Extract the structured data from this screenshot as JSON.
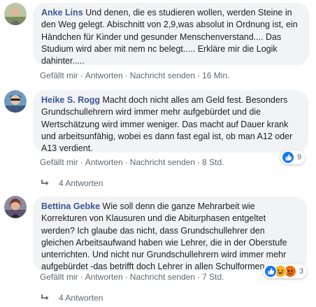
{
  "comments": [
    {
      "author": "Anke Lins",
      "text": "Und denen, die es studieren wollen, werden Steine in den Weg gelegt. Abischnitt von 2,9,was absolut in Ordnung ist, ein Händchen für Kinder und gesunder Menschenverstand.... Das Studium wird aber mit nem nc belegt..... Erkläre mir die Logik dahinter.....",
      "actions": {
        "like": "Gefällt mir",
        "reply": "Antworten",
        "message": "Nachricht senden",
        "time": "16 Min."
      }
    },
    {
      "author": "Heike S. Rogg",
      "text": "Macht doch nicht alles am Geld fest. Besonders Grundschullehrern wird immer mehr aufgebürdet und die Wertschätzung wird immer weniger. Das macht auf Dauer krank und arbeitsunfähig, wobei es dann fast egal ist, ob man A12 oder A13 verdient.",
      "actions": {
        "like": "Gefällt mir",
        "reply": "Antworten",
        "message": "Nachricht senden",
        "time": "8 Std."
      },
      "reactions": {
        "icons": [
          "like-icon"
        ],
        "count": "9"
      },
      "replies_label": "4 Antworten"
    },
    {
      "author": "Bettina Gebke",
      "text": "Wie soll denn die ganze Mehrarbeit wie Korrekturen von Klausuren und die Abiturphasen entgeltet werden? Ich glaube das nicht, dass Grundschullehrer den gleichen Arbeitsaufwand haben wie Lehrer, die in der Oberstufe unterrichten. Und nicht nur Grundschullehrern wird immer mehr aufgebürdet -das betrifft doch Lehrer in allen Schulformen.",
      "actions": {
        "like": "Gefällt mir",
        "reply": "Antworten",
        "message": "Nachricht senden",
        "time": "7 Std."
      },
      "reactions": {
        "icons": [
          "like-icon",
          "haha-icon",
          "angry-icon"
        ],
        "count": "3"
      },
      "replies_label": "4 Antworten"
    }
  ],
  "separator": "·",
  "colors": {
    "link": "#385898",
    "bubble": "#f2f3f5",
    "meta": "#606770",
    "like": "#1877f2",
    "haha": "#f7b125",
    "angry": "#e9710f"
  }
}
